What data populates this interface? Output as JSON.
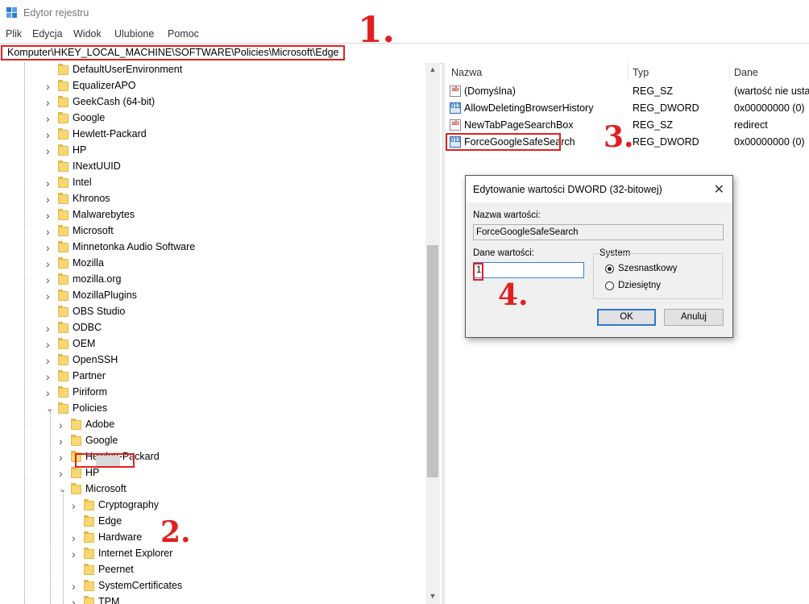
{
  "window": {
    "title": "Edytor rejestru"
  },
  "menu": [
    "Plik",
    "Edycja",
    "Widok",
    "Ulubione",
    "Pomoc"
  ],
  "address": "Komputer\\HKEY_LOCAL_MACHINE\\SOFTWARE\\Policies\\Microsoft\\Edge",
  "tree": [
    {
      "label": "DefaultUserEnvironment",
      "expander": "none"
    },
    {
      "label": "EqualizerAPO",
      "expander": "collapsed"
    },
    {
      "label": "GeekCash (64-bit)",
      "expander": "collapsed"
    },
    {
      "label": "Google",
      "expander": "collapsed"
    },
    {
      "label": "Hewlett-Packard",
      "expander": "collapsed"
    },
    {
      "label": "HP",
      "expander": "collapsed"
    },
    {
      "label": "INextUUID",
      "expander": "none"
    },
    {
      "label": "Intel",
      "expander": "collapsed"
    },
    {
      "label": "Khronos",
      "expander": "collapsed"
    },
    {
      "label": "Malwarebytes",
      "expander": "collapsed"
    },
    {
      "label": "Microsoft",
      "expander": "collapsed"
    },
    {
      "label": "Minnetonka Audio Software",
      "expander": "collapsed"
    },
    {
      "label": "Mozilla",
      "expander": "collapsed"
    },
    {
      "label": "mozilla.org",
      "expander": "collapsed"
    },
    {
      "label": "MozillaPlugins",
      "expander": "collapsed"
    },
    {
      "label": "OBS Studio",
      "expander": "none"
    },
    {
      "label": "ODBC",
      "expander": "collapsed"
    },
    {
      "label": "OEM",
      "expander": "collapsed"
    },
    {
      "label": "OpenSSH",
      "expander": "collapsed"
    },
    {
      "label": "Partner",
      "expander": "collapsed"
    },
    {
      "label": "Piriform",
      "expander": "collapsed"
    },
    {
      "label": "Policies",
      "expander": "expanded"
    },
    {
      "label": "Adobe",
      "expander": "collapsed"
    },
    {
      "label": "Google",
      "expander": "collapsed"
    },
    {
      "label": "Hewlett-Packard",
      "expander": "collapsed"
    },
    {
      "label": "HP",
      "expander": "collapsed"
    },
    {
      "label": "Microsoft",
      "expander": "expanded"
    },
    {
      "label": "Cryptography",
      "expander": "collapsed"
    },
    {
      "label": "Edge",
      "expander": "none",
      "selected": true
    },
    {
      "label": "Hardware",
      "expander": "collapsed"
    },
    {
      "label": "Internet Explorer",
      "expander": "collapsed"
    },
    {
      "label": "Peernet",
      "expander": "none"
    },
    {
      "label": "SystemCertificates",
      "expander": "collapsed"
    },
    {
      "label": "TPM",
      "expander": "collapsed"
    }
  ],
  "list": {
    "columns": [
      "Nazwa",
      "Typ",
      "Dane"
    ],
    "rows": [
      {
        "icon": "string-value-icon",
        "name": "(Domyślna)",
        "type": "REG_SZ",
        "data": "(wartość nie ustawiona)"
      },
      {
        "icon": "dword-value-icon",
        "name": "AllowDeletingBrowserHistory",
        "type": "REG_DWORD",
        "data": "0x00000000 (0)"
      },
      {
        "icon": "string-value-icon",
        "name": "NewTabPageSearchBox",
        "type": "REG_SZ",
        "data": "redirect"
      },
      {
        "icon": "dword-value-icon",
        "name": "ForceGoogleSafeSearch",
        "type": "REG_DWORD",
        "data": "0x00000000 (0)"
      }
    ]
  },
  "dialog": {
    "title": "Edytowanie wartości DWORD (32-bitowej)",
    "name_label": "Nazwa wartości:",
    "name_value": "ForceGoogleSafeSearch",
    "data_label": "Dane wartości:",
    "data_value": "1",
    "base_label": "System",
    "base_hex": "Szesnastkowy",
    "base_dec": "Dziesiętny",
    "base_selected": "hex",
    "ok": "OK",
    "cancel": "Anuluj"
  },
  "annotations": [
    "1.",
    "2.",
    "3.",
    "4."
  ]
}
